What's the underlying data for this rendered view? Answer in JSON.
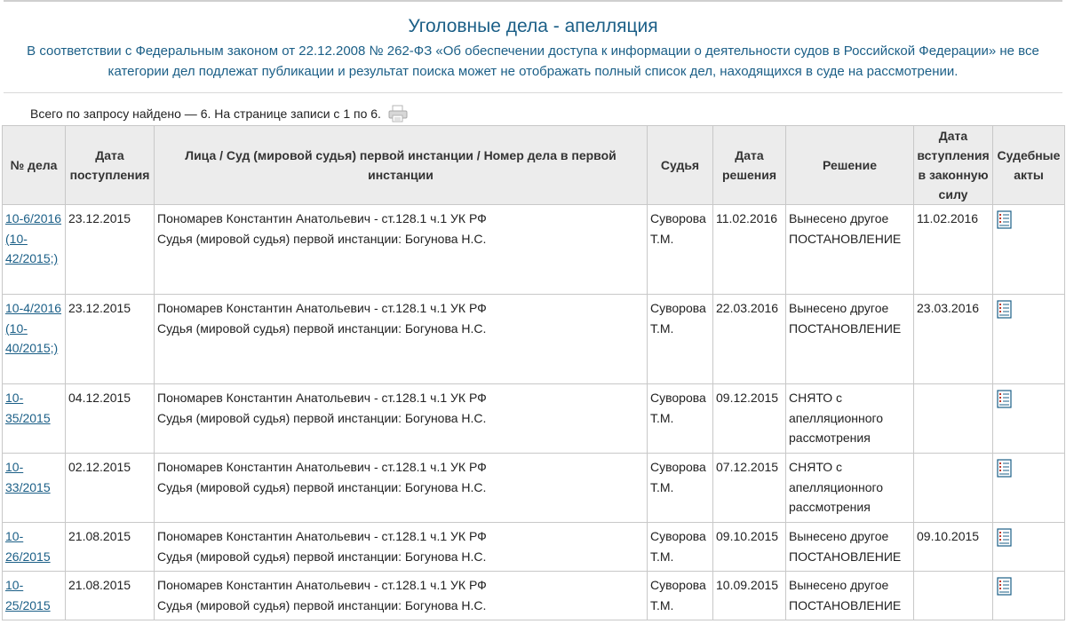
{
  "page": {
    "title": "Уголовные дела - апелляция",
    "notice": "В соответствии с Федеральным законом от 22.12.2008 № 262-ФЗ «Об обеспечении доступа к информации о деятельности судов в Российской Федерации» не все категории дел подлежат публикации и результат поиска может не отображать полный список дел, находящихся в суде на рассмотрении.",
    "summary": "Всего по запросу найдено — 6. На странице записи с 1 по 6."
  },
  "icons": {
    "print": "printer-icon",
    "document": "document-icon"
  },
  "colors": {
    "link": "#1b5f87",
    "header_bg": "#ececec",
    "border": "#c8c8c8"
  },
  "table": {
    "headers": {
      "number": "№ дела",
      "received": "Дата поступления",
      "parties": "Лица / Суд (мировой судья) первой инстанции / Номер дела в первой инстанции",
      "judge": "Судья",
      "decision_date": "Дата решения",
      "decision": "Решение",
      "effective_date": "Дата вступления в законную силу",
      "acts": "Судебные акты"
    },
    "rows": [
      {
        "number": "10-6/2016 (10-42/2015;)",
        "received": "23.12.2015",
        "person": "Пономарев Константин Анатольевич - ст.128.1 ч.1 УК РФ",
        "lower_court": "Судья (мировой судья) первой инстанции: Богунова Н.С.",
        "judge": "Суворова Т.М.",
        "decision_date": "11.02.2016",
        "decision": "Вынесено другое ПОСТАНОВЛЕНИЕ",
        "effective_date": "11.02.2016"
      },
      {
        "number": "10-4/2016 (10-40/2015;)",
        "received": "23.12.2015",
        "person": "Пономарев Константин Анатольевич - ст.128.1 ч.1 УК РФ",
        "lower_court": "Судья (мировой судья) первой инстанции: Богунова Н.С.",
        "judge": "Суворова Т.М.",
        "decision_date": "22.03.2016",
        "decision": "Вынесено другое ПОСТАНОВЛЕНИЕ",
        "effective_date": "23.03.2016"
      },
      {
        "number": "10-35/2015",
        "received": "04.12.2015",
        "person": "Пономарев Константин Анатольевич - ст.128.1 ч.1 УК РФ",
        "lower_court": "Судья (мировой судья) первой инстанции: Богунова Н.С.",
        "judge": "Суворова Т.М.",
        "decision_date": "09.12.2015",
        "decision": "СНЯТО с апелляционного рассмотрения",
        "effective_date": ""
      },
      {
        "number": "10-33/2015",
        "received": "02.12.2015",
        "person": "Пономарев Константин Анатольевич - ст.128.1 ч.1 УК РФ",
        "lower_court": "Судья (мировой судья) первой инстанции: Богунова Н.С.",
        "judge": "Суворова Т.М.",
        "decision_date": "07.12.2015",
        "decision": "СНЯТО с апелляционного рассмотрения",
        "effective_date": ""
      },
      {
        "number": "10-26/2015",
        "received": "21.08.2015",
        "person": "Пономарев Константин Анатольевич - ст.128.1 ч.1 УК РФ",
        "lower_court": "Судья (мировой судья) первой инстанции: Богунова Н.С.",
        "judge": "Суворова Т.М.",
        "decision_date": "09.10.2015",
        "decision": "Вынесено другое ПОСТАНОВЛЕНИЕ",
        "effective_date": "09.10.2015"
      },
      {
        "number": "10-25/2015",
        "received": "21.08.2015",
        "person": "Пономарев Константин Анатольевич - ст.128.1 ч.1 УК РФ",
        "lower_court": "Судья (мировой судья) первой инстанции: Богунова Н.С.",
        "judge": "Суворова Т.М.",
        "decision_date": "10.09.2015",
        "decision": "Вынесено другое ПОСТАНОВЛЕНИЕ",
        "effective_date": ""
      }
    ]
  }
}
